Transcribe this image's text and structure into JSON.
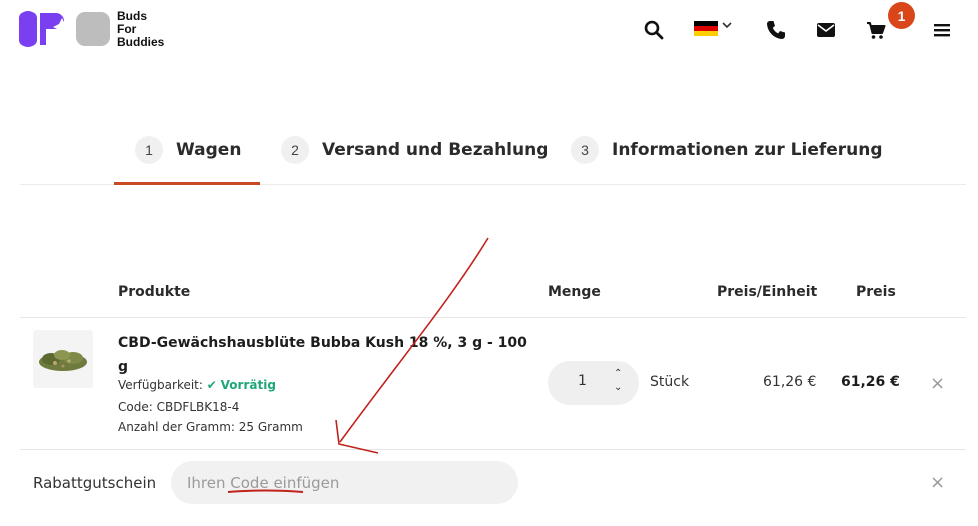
{
  "header": {
    "brand_lines": [
      "Buds",
      "For",
      "Buddies"
    ],
    "icons": [
      "search-icon",
      "flag-germany-icon",
      "chevron-down-icon",
      "phone-icon",
      "mail-icon",
      "cart-icon",
      "menu-icon"
    ],
    "cart_count": "1"
  },
  "steps": [
    {
      "num": "1",
      "label": "Wagen"
    },
    {
      "num": "2",
      "label": "Versand und Bezahlung"
    },
    {
      "num": "3",
      "label": "Informationen zur Lieferung"
    }
  ],
  "table": {
    "headers": {
      "product": "Produkte",
      "quantity": "Menge",
      "unit_price": "Preis/Einheit",
      "price": "Preis"
    },
    "rows": [
      {
        "name": "CBD-Gewächshausblüte Bubba Kush 18 %, 3 g - 100 g",
        "availability_label": "Verfügbarkeit:",
        "availability_value": "Vorrätig",
        "code": "Code: CBDFLBK18-4",
        "grams": "Anzahl der Gramm: 25 Gramm",
        "quantity": "1",
        "unit": "Stück",
        "unit_price": "61,26 €",
        "price": "61,26 €"
      }
    ]
  },
  "coupon": {
    "label": "Rabattgutschein",
    "placeholder": "Ihren Code einfügen"
  },
  "colors": {
    "accent": "#c94a22",
    "badge": "#d9461a",
    "in_stock": "#1fa67a",
    "logo_purple": "#7b3ff2",
    "logo_gray": "#bdbdbd",
    "annotation": "#c0231b"
  }
}
